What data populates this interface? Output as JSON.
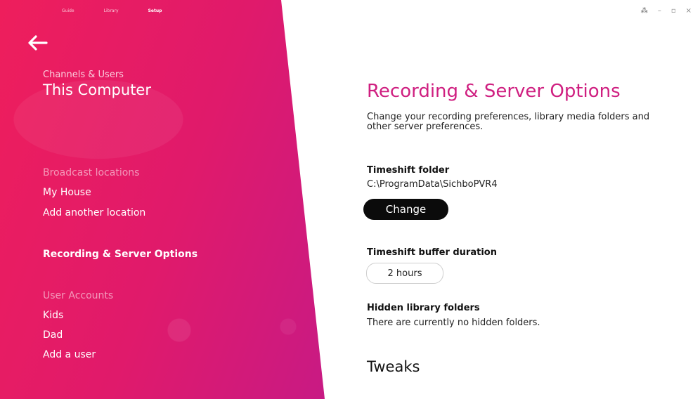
{
  "top_nav": {
    "items": [
      "Guide",
      "Library",
      "Setup"
    ],
    "active_index": 2
  },
  "window_controls": {
    "icon_1": "grid-icon",
    "minimize": "–",
    "restore": "▫",
    "close": "×"
  },
  "sidebar": {
    "subheading": "Channels & Users",
    "heading": "This Computer",
    "broadcast_section": "Broadcast locations",
    "broadcast_items": [
      "My House",
      "Add another location"
    ],
    "recording_item": "Recording & Server Options",
    "users_section": "User Accounts",
    "user_items": [
      "Kids",
      "Dad",
      "Add a user"
    ]
  },
  "main": {
    "title": "Recording & Server Options",
    "description": "Change your recording preferences, library media folders and other server preferences.",
    "timeshift_folder_label": "Timeshift folder",
    "timeshift_folder_value": "C:\\ProgramData\\SichboPVR4",
    "change_button": "Change",
    "buffer_label": "Timeshift buffer duration",
    "buffer_value": "2 hours",
    "hidden_label": "Hidden library folders",
    "hidden_value": "There are currently no hidden folders.",
    "tweaks_heading": "Tweaks"
  },
  "colors": {
    "accent": "#cf1f80",
    "sidebar_start": "#ee1e5c",
    "sidebar_end": "#a81f96"
  }
}
